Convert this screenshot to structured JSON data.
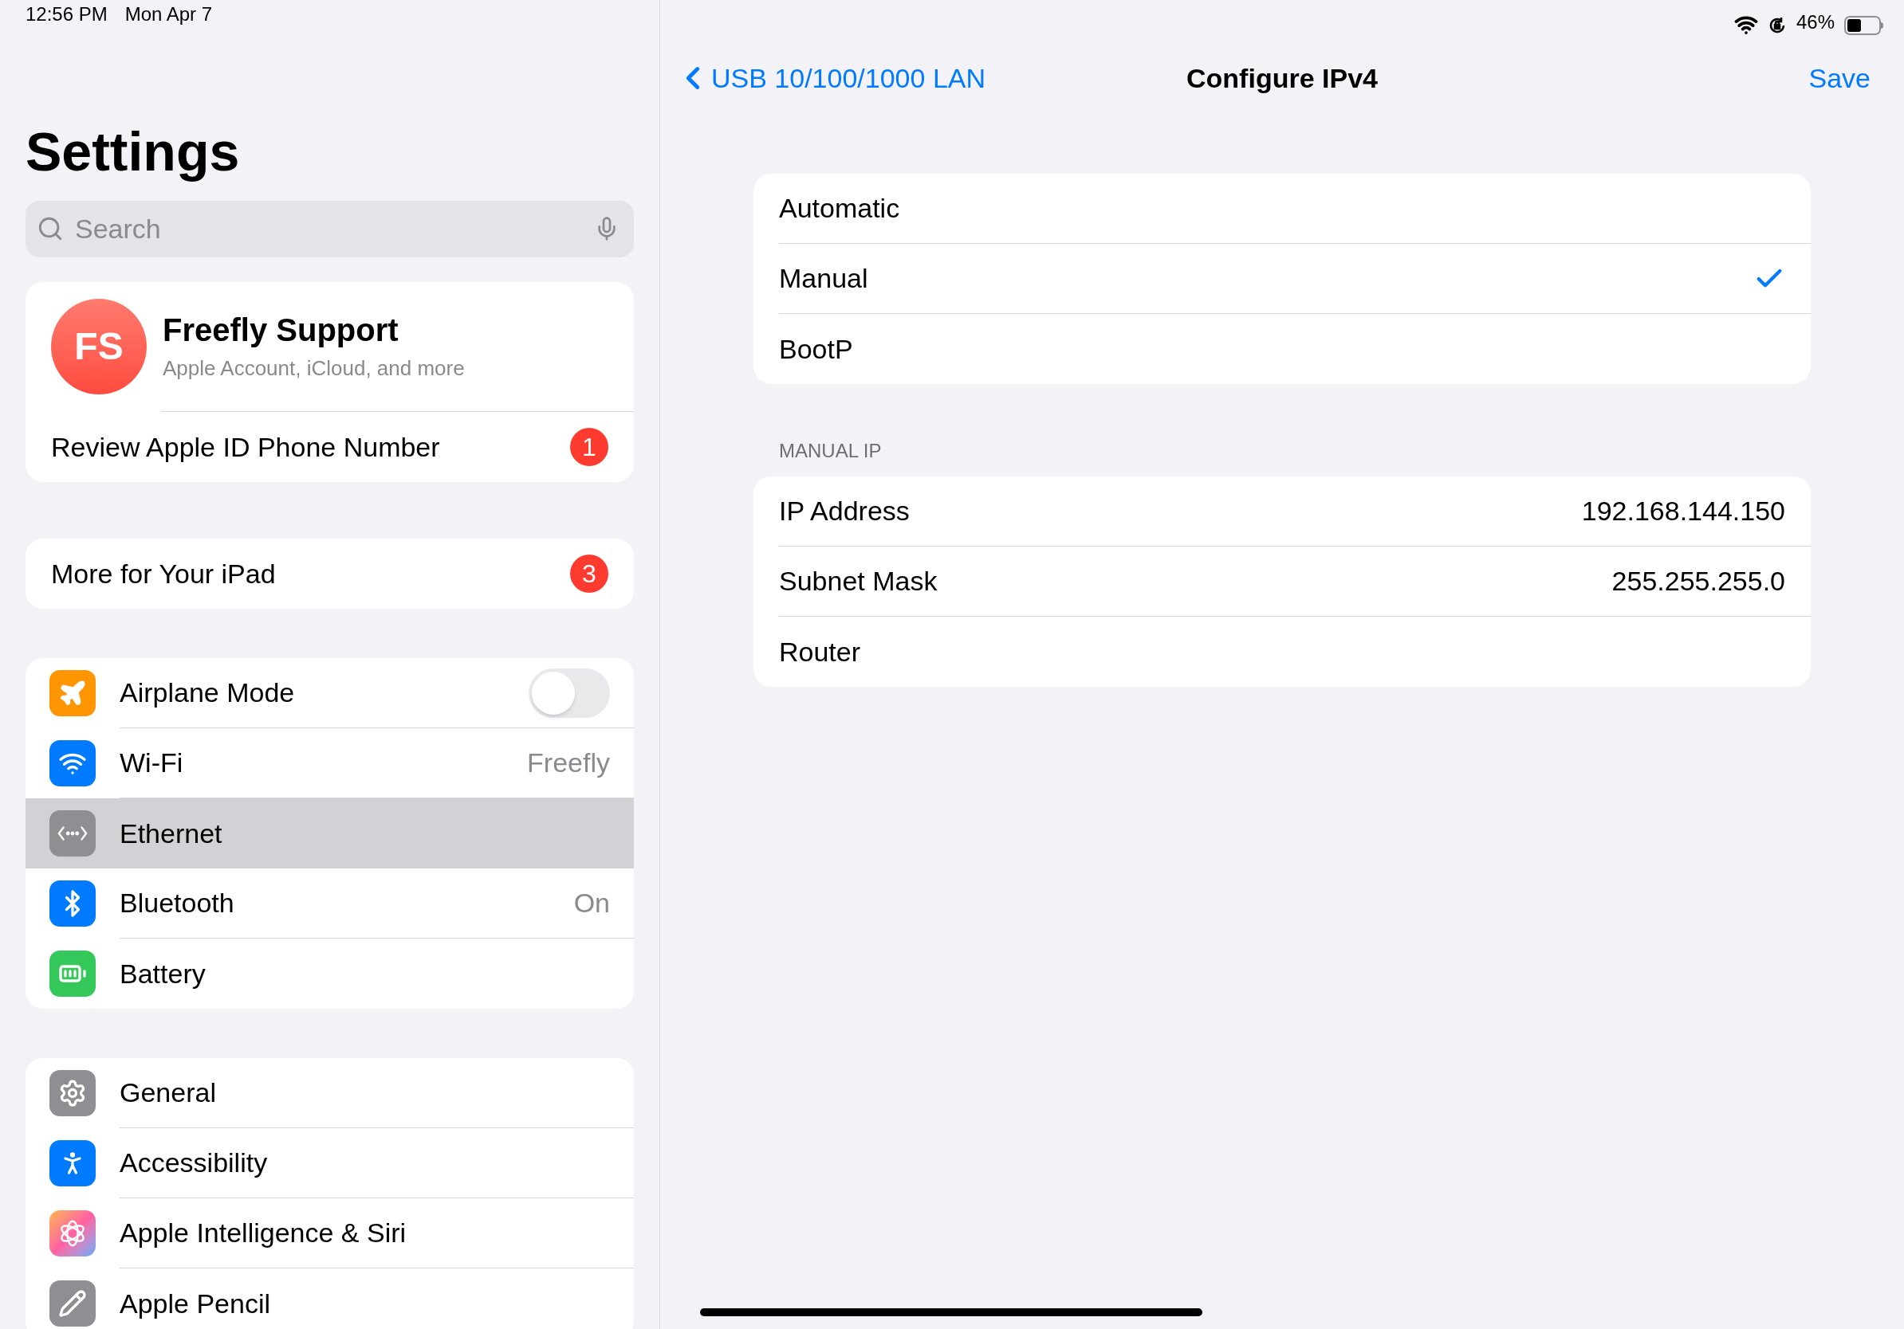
{
  "status_bar": {
    "time": "12:56 PM",
    "date": "Mon Apr 7",
    "battery_percent": "46%"
  },
  "sidebar": {
    "title": "Settings",
    "search": {
      "placeholder": "Search"
    },
    "account": {
      "initials": "FS",
      "name": "Freefly Support",
      "subtitle": "Apple Account, iCloud, and more"
    },
    "account_alert": {
      "label": "Review Apple ID Phone Number",
      "badge": "1"
    },
    "promo": {
      "label": "More for Your iPad",
      "badge": "3"
    },
    "groups": [
      {
        "items": [
          {
            "label": "Airplane Mode",
            "kind": "toggle",
            "on": false,
            "selected": false
          },
          {
            "label": "Wi-Fi",
            "kind": "value",
            "value": "Freefly",
            "selected": false
          },
          {
            "label": "Ethernet",
            "kind": "plain",
            "selected": true
          },
          {
            "label": "Bluetooth",
            "kind": "value",
            "value": "On",
            "selected": false
          },
          {
            "label": "Battery",
            "kind": "plain",
            "selected": false
          }
        ]
      },
      {
        "items": [
          {
            "label": "General",
            "kind": "plain",
            "selected": false
          },
          {
            "label": "Accessibility",
            "kind": "plain",
            "selected": false
          },
          {
            "label": "Apple Intelligence & Siri",
            "kind": "plain",
            "selected": false
          },
          {
            "label": "Apple Pencil",
            "kind": "plain",
            "selected": false
          }
        ]
      }
    ]
  },
  "detail": {
    "nav": {
      "back": "USB 10/100/1000 LAN",
      "title": "Configure IPv4",
      "action": "Save"
    },
    "methods": [
      {
        "label": "Automatic",
        "selected": false
      },
      {
        "label": "Manual",
        "selected": true
      },
      {
        "label": "BootP",
        "selected": false
      }
    ],
    "section_header": "MANUAL IP",
    "fields": [
      {
        "label": "IP Address",
        "value": "192.168.144.150"
      },
      {
        "label": "Subnet Mask",
        "value": "255.255.255.0"
      },
      {
        "label": "Router"
      }
    ]
  }
}
